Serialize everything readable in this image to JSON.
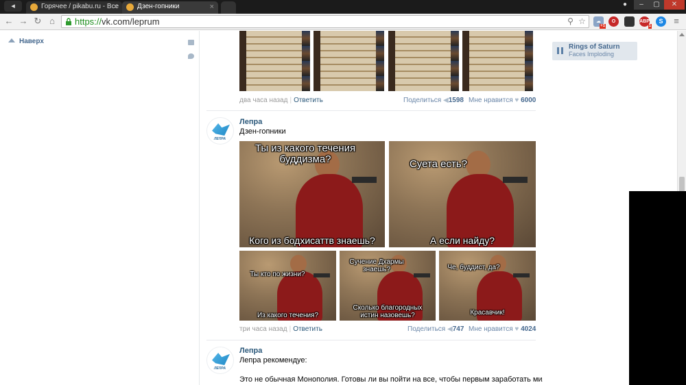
{
  "browser": {
    "tabs": [
      {
        "title": "Горячее / pikabu.ru - Все"
      },
      {
        "title": "Дзен-гопники"
      }
    ],
    "url_scheme": "https://",
    "url_rest": "vk.com/leprum",
    "extensions": [
      {
        "name": "weather-ext",
        "badge": "+1",
        "color": "#6f8bb0",
        "label": ""
      },
      {
        "name": "adblock-plus",
        "badge": "1",
        "color": "#c62828",
        "label": "ABP"
      },
      {
        "name": "skype-ext",
        "badge": "",
        "color": "#1e88e5",
        "label": "S"
      }
    ]
  },
  "left": {
    "naverh": "Наверх"
  },
  "player": {
    "title": "Rings of Saturn",
    "artist": "Faces Imploding"
  },
  "posts": [
    {
      "time": "два часа назад",
      "reply": "Ответить",
      "share_label": "Поделиться",
      "share_count": "1598",
      "like_label": "Мне нравится",
      "like_count": "6000"
    },
    {
      "author": "Лепра",
      "text": "Дзен-гопники",
      "memes": [
        {
          "top": "Ты из какого течения буддизма?",
          "bottom": "Кого из бодхисаттв знаешь?"
        },
        {
          "top": "Суета есть?",
          "bottom": "А если найду?"
        },
        {
          "top": "Ты кто по жизни?",
          "bottom": "Из какого течения?"
        },
        {
          "top": "Сучение Дхармы знаешь?",
          "bottom": "Сколько благородных истин назовешь?"
        },
        {
          "top": "Че, буддист, да?",
          "bottom": "Красавчик!"
        }
      ],
      "time": "три часа назад",
      "reply": "Ответить",
      "share_label": "Поделиться",
      "share_count": "747",
      "like_label": "Мне нравится",
      "like_count": "4024"
    },
    {
      "author": "Лепра",
      "text": "Лепра рекомендуе:",
      "body": "Это не обычная Монополия. Готовы ли вы пойти на все, чтобы первым заработать миллион и стать"
    }
  ],
  "avatar_label": "ЛЕПРА"
}
